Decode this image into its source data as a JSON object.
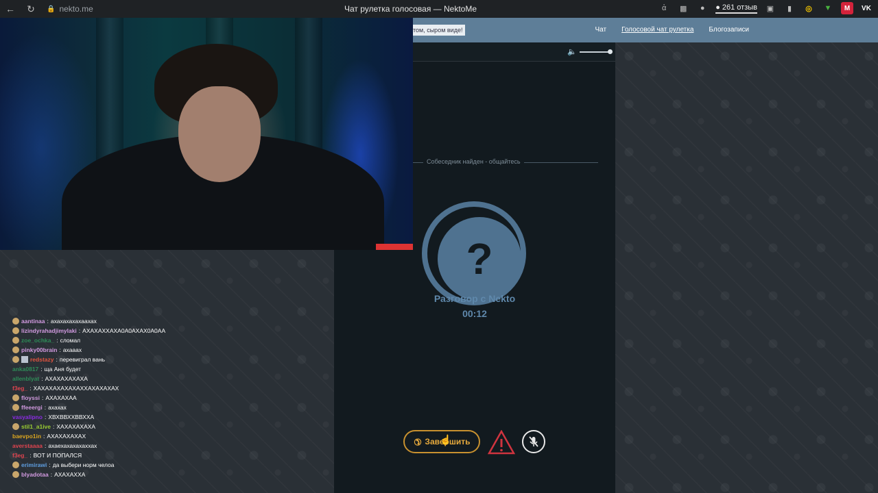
{
  "browser": {
    "url": "nekto.me",
    "tab_title": "Чат рулетка голосовая — NektoMe",
    "reviews_label": "261 отзыв",
    "ext_m": "M",
    "ext_vk": "VK"
  },
  "header": {
    "notice": "том, сыром виде!",
    "nav": {
      "chat": "Чат",
      "voice_roulette": "Голосовой чат рулетка",
      "blog": "Блогозаписи"
    }
  },
  "call": {
    "found_text": "Собеседник найден - общайтесь",
    "avatar_glyph": "?",
    "title": "Разговор с Nekto",
    "timer": "00:12",
    "end_label": "Завершить"
  },
  "colors": {
    "accent_blue": "#4f7290",
    "end_button": "#e6a93c",
    "report_red": "#d0343f"
  },
  "twitch_chat": [
    {
      "user": "aantinaa",
      "text": "ахахахахахаахах",
      "color": "#d29ae0",
      "emote": true
    },
    {
      "user": "lizindyrahadjimylaki",
      "text": "АХАХАХХАХА0А0АХАХ0А0АА",
      "color": "#d29ae0",
      "emote": true
    },
    {
      "user": "zoe_ochka_",
      "text": "сломал",
      "color": "#2e8b57",
      "emote": true
    },
    {
      "user": "pinky00brain",
      "text": "ахааах",
      "color": "#d29ae0",
      "emote": true
    },
    {
      "user": "redstazy",
      "text": "перевиграл вань",
      "color": "#e0543f",
      "emote": true,
      "badge": true
    },
    {
      "user": "anka0817",
      "text": "ща Аня будет",
      "color": "#2e8b57",
      "emote": false
    },
    {
      "user": "allenblyat",
      "text": "АХАХАХАХАХА",
      "color": "#2e8b57",
      "emote": false
    },
    {
      "user": "f3eg_",
      "text": "ХАХАХАХАХАХАХХАХАХАХАХ",
      "color": "#e0444f",
      "emote": false
    },
    {
      "user": "floyssi",
      "text": "АХАХАХАА",
      "color": "#d29ae0",
      "emote": true
    },
    {
      "user": "ffeeergi",
      "text": "ахахах",
      "color": "#d29ae0",
      "emote": true
    },
    {
      "user": "vasyalipno",
      "text": "ХВХВВХХВВХХА",
      "color": "#8a2be2",
      "emote": false
    },
    {
      "user": "stil1_a1ive",
      "text": "ХАХАХАХАХА",
      "color": "#9acd32",
      "emote": true
    },
    {
      "user": "baevpo1in",
      "text": "АХАХАХАХАХ",
      "color": "#daa520",
      "emote": false
    },
    {
      "user": "averstaaaa",
      "text": "ахаехахахахаххах",
      "color": "#e0444f",
      "emote": false
    },
    {
      "user": "f3eg_",
      "text": "ВОТ И ПОПАЛСЯ",
      "color": "#e0444f",
      "emote": false
    },
    {
      "user": "erimirawi",
      "text": "да выбери норм челоа",
      "color": "#5f9ee0",
      "emote": true
    },
    {
      "user": "blyadotaa",
      "text": "АХАХАХХА",
      "color": "#d29ae0",
      "emote": true
    }
  ]
}
